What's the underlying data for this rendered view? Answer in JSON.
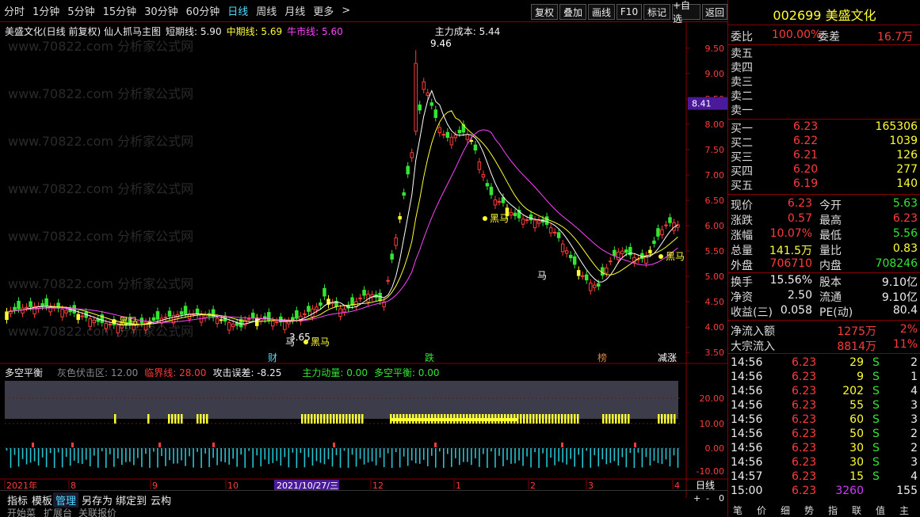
{
  "toolbar": {
    "periods": [
      "分时",
      "1分钟",
      "5分钟",
      "15分钟",
      "30分钟",
      "60分钟",
      "日线",
      "周线",
      "月线",
      "更多"
    ],
    "more_arrow": ">",
    "right_buttons": [
      "复权",
      "叠加",
      "画线",
      "F10",
      "标记",
      "+自选",
      "返回"
    ]
  },
  "main_header": {
    "stock_info": "美盛文化(日线 前复权) 仙人抓马主图",
    "short_line": "短期线: 5.90",
    "mid_line": "中期线: 5.69",
    "bull_line": "牛市线: 5.60",
    "main_cost": "主力成本: 5.44"
  },
  "price_axis": [
    "9.50",
    "9.00",
    "8.50",
    "8.00",
    "7.50",
    "7.00",
    "6.50",
    "6.00",
    "5.50",
    "5.00",
    "4.50",
    "4.00",
    "3.50"
  ],
  "current_price_tag": "8.41",
  "annotations": {
    "high": "9.46",
    "low": "3.65",
    "markers": [
      "黑马",
      "黑马",
      "黑马",
      "黑马"
    ],
    "horse": [
      "马",
      "马"
    ],
    "events": [
      "财",
      "跌",
      "榜",
      "减涨"
    ]
  },
  "sub_header": {
    "name": "多空平衡",
    "gray_zone": "灰色伏击区: 12.00",
    "critical": "临界线: 28.00",
    "attack_error": "攻击误差: -8.25",
    "main_momentum": "主力动量: 0.00",
    "balance": "多空平衡: 0.00"
  },
  "sub_axis": [
    "20.00",
    "10.00",
    "0.00",
    "-10.00"
  ],
  "time_axis": [
    "2021年",
    "8",
    "9",
    "10",
    "11",
    "12",
    "1",
    "2",
    "3",
    "4"
  ],
  "cursor_date": "2021/10/27/三",
  "period_label": "日线",
  "bottom_tabs": [
    "指标",
    "模板",
    "管理",
    "另存为",
    "绑定到",
    "云构"
  ],
  "bottom_tabs2": [
    "开始菜",
    "扩展台",
    "关联报价"
  ],
  "zoom": [
    "+",
    "-",
    "0"
  ],
  "watermark": "www.70822.com 分析家公式网",
  "quote": {
    "code_name": "002699 美盛文化",
    "weibi_label": "委比",
    "weibi": "100.00%",
    "weicha_label": "委差",
    "weicha": "16.7万",
    "sell": [
      "卖五",
      "卖四",
      "卖三",
      "卖二",
      "卖一"
    ],
    "buy": [
      {
        "label": "买一",
        "price": "6.23",
        "vol": "165306"
      },
      {
        "label": "买二",
        "price": "6.22",
        "vol": "1039"
      },
      {
        "label": "买三",
        "price": "6.21",
        "vol": "126"
      },
      {
        "label": "买四",
        "price": "6.20",
        "vol": "277"
      },
      {
        "label": "买五",
        "price": "6.19",
        "vol": "140"
      }
    ],
    "stats": [
      {
        "l1": "现价",
        "v1": "6.23",
        "c1": "red",
        "l2": "今开",
        "v2": "5.63",
        "c2": "green"
      },
      {
        "l1": "涨跌",
        "v1": "0.57",
        "c1": "red",
        "l2": "最高",
        "v2": "6.23",
        "c2": "red"
      },
      {
        "l1": "涨幅",
        "v1": "10.07%",
        "c1": "red",
        "l2": "最低",
        "v2": "5.56",
        "c2": "green"
      },
      {
        "l1": "总量",
        "v1": "141.5万",
        "c1": "yellow",
        "l2": "量比",
        "v2": "0.83",
        "c2": "yellow"
      },
      {
        "l1": "外盘",
        "v1": "706710",
        "c1": "red",
        "l2": "内盘",
        "v2": "708246",
        "c2": "green"
      }
    ],
    "stats2": [
      {
        "l1": "换手",
        "v1": "15.56%",
        "l2": "股本",
        "v2": "9.10亿"
      },
      {
        "l1": "净资",
        "v1": "2.50",
        "l2": "流通",
        "v2": "9.10亿"
      },
      {
        "l1": "收益(三)",
        "v1": "0.058",
        "l2": "PE(动)",
        "v2": "80.4"
      }
    ],
    "flow": [
      {
        "label": "净流入额",
        "v": "1275万",
        "p": "2%"
      },
      {
        "label": "大宗流入",
        "v": "8814万",
        "p": "11%"
      }
    ],
    "ticks": [
      {
        "t": "14:56",
        "p": "6.23",
        "v": "29",
        "s": "S",
        "n": "2"
      },
      {
        "t": "14:56",
        "p": "6.23",
        "v": "9",
        "s": "S",
        "n": "1"
      },
      {
        "t": "14:56",
        "p": "6.23",
        "v": "202",
        "s": "S",
        "n": "4"
      },
      {
        "t": "14:56",
        "p": "6.23",
        "v": "55",
        "s": "S",
        "n": "3"
      },
      {
        "t": "14:56",
        "p": "6.23",
        "v": "60",
        "s": "S",
        "n": "3"
      },
      {
        "t": "14:56",
        "p": "6.23",
        "v": "50",
        "s": "S",
        "n": "2"
      },
      {
        "t": "14:56",
        "p": "6.23",
        "v": "30",
        "s": "S",
        "n": "2"
      },
      {
        "t": "14:56",
        "p": "6.23",
        "v": "30",
        "s": "S",
        "n": "3"
      },
      {
        "t": "14:57",
        "p": "6.23",
        "v": "15",
        "s": "S",
        "n": "4"
      },
      {
        "t": "15:00",
        "p": "6.23",
        "v": "3260",
        "s": "",
        "n": "155"
      }
    ],
    "bottom_tabs": [
      "笔",
      "价",
      "细",
      "势",
      "指",
      "联",
      "值",
      "主"
    ]
  },
  "colors": {
    "up": "#ff3b3b",
    "down": "#33e633",
    "limit_up": "#ffff33",
    "ma_short": "#ffffff",
    "ma_mid": "#ffff33",
    "ma_bull": "#ff44ff",
    "cyan": "#22c5d6",
    "border": "#880000"
  }
}
